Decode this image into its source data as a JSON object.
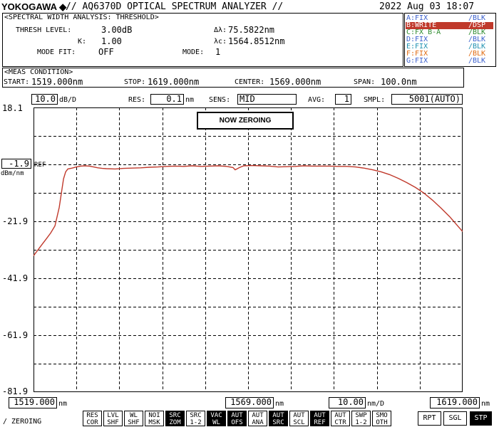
{
  "header": {
    "brand": "YOKOGAWA",
    "title": "// AQ6370D OPTICAL SPECTRUM ANALYZER //",
    "datetime": "2022 Aug 03 18:07"
  },
  "analysis": {
    "title": "<SPECTRAL WIDTH ANALYSIS: THRESHOLD>",
    "thresh_label": "THRESH LEVEL:",
    "thresh_value": "3.00dB",
    "k_label": "K:",
    "k_value": "1.00",
    "mode_fit_label": "MODE FIT:",
    "mode_fit_value": "OFF",
    "dlambda_label": "Δλ:",
    "dlambda_value": "75.5822nm",
    "lambdac_label": "λc:",
    "lambdac_value": "1564.8512nm",
    "mode_label": "MODE:",
    "mode_value": "1"
  },
  "traces": [
    {
      "name": "A:FIX",
      "mode": "/BLK",
      "color": "#3a5fcd",
      "active": false
    },
    {
      "name": "B:WRITE",
      "mode": "/DSP",
      "color": "#c0392b",
      "active": true
    },
    {
      "name": "C:FX B-A",
      "mode": "/BLK",
      "color": "#2e8b2e",
      "active": false
    },
    {
      "name": "D:FIX",
      "mode": "/BLK",
      "color": "#3a5fcd",
      "active": false
    },
    {
      "name": "E:FIX",
      "mode": "/BLK",
      "color": "#1e90b0",
      "active": false
    },
    {
      "name": "F:FIX",
      "mode": "/BLK",
      "color": "#e06a10",
      "active": false
    },
    {
      "name": "G:FIX",
      "mode": "/BLK",
      "color": "#3a5fcd",
      "active": false
    }
  ],
  "meas": {
    "title": "<MEAS CONDITION>",
    "start_label": "START:",
    "start_value": "1519.000nm",
    "stop_label": "STOP:",
    "stop_value": "1619.000nm",
    "center_label": "CENTER:",
    "center_value": "1569.000nm",
    "span_label": "SPAN:",
    "span_value": "100.0nm"
  },
  "settings": {
    "scale_value": "10.0",
    "scale_unit": "dB/D",
    "res_label": "RES:",
    "res_value": "0.1",
    "res_unit": "nm",
    "sens_label": "SENS:",
    "sens_value": "MID",
    "avg_label": "AVG:",
    "avg_value": "1",
    "smpl_label": "SMPL:",
    "smpl_value": "5001(AUTO)"
  },
  "plot": {
    "ref_value": "-1.9",
    "ref_tag": "REF",
    "ref_unit": "dBm/nm",
    "y_ticks": [
      "18.1",
      "-21.9",
      "-41.9",
      "-61.9",
      "-81.9"
    ],
    "zeroing_message": "NOW ZEROING",
    "x_start": "1519.000",
    "x_start_unit": "nm",
    "x_center": "1569.000",
    "x_center_unit": "nm",
    "x_div": "10.00",
    "x_div_unit": "nm/D",
    "x_stop": "1619.000",
    "x_stop_unit": "nm",
    "trace_color": "#c0392b"
  },
  "chart_data": {
    "type": "line",
    "xlim": [
      1519,
      1619
    ],
    "ylim": [
      -81.9,
      18.1
    ],
    "x_divisions": 10,
    "y_divisions": 10,
    "grid": true,
    "series": [
      {
        "x": [
          1519,
          1520,
          1521,
          1522,
          1523,
          1524,
          1525,
          1526,
          1526.5,
          1527,
          1528,
          1529,
          1530,
          1531,
          1532,
          1533,
          1534,
          1535,
          1536,
          1538,
          1540,
          1542,
          1544,
          1546,
          1548,
          1550,
          1552,
          1554,
          1556,
          1558,
          1560,
          1562,
          1564,
          1565.5,
          1566,
          1567,
          1568,
          1570,
          1572,
          1574,
          1576,
          1578,
          1580,
          1582,
          1584,
          1586,
          1588,
          1590,
          1592,
          1594,
          1596,
          1598,
          1600,
          1602,
          1604,
          1606,
          1608,
          1610,
          1612,
          1614,
          1616,
          1618,
          1619
        ],
        "y": [
          -34,
          -32,
          -30,
          -28,
          -26,
          -23.5,
          -17,
          -7,
          -4.5,
          -3.5,
          -3.2,
          -2.8,
          -2.5,
          -2.4,
          -2.5,
          -2.8,
          -3.1,
          -3.3,
          -3.4,
          -3.5,
          -3.3,
          -3.2,
          -3.1,
          -2.9,
          -2.8,
          -2.6,
          -2.5,
          -2.6,
          -2.4,
          -2.6,
          -2.5,
          -2.4,
          -2.6,
          -3.0,
          -3.8,
          -3.0,
          -2.4,
          -2.3,
          -2.4,
          -2.5,
          -2.8,
          -2.7,
          -2.6,
          -2.4,
          -2.5,
          -2.5,
          -2.5,
          -2.6,
          -2.6,
          -2.8,
          -3.2,
          -3.8,
          -4.5,
          -5.5,
          -6.8,
          -8.3,
          -10,
          -12,
          -14.5,
          -17.3,
          -20.3,
          -23.8,
          -25.5
        ]
      }
    ]
  },
  "softkeys": [
    {
      "l1": "RES",
      "l2": "COR",
      "on": false
    },
    {
      "l1": "LVL",
      "l2": "SHF",
      "on": false
    },
    {
      "l1": "WL",
      "l2": "SHF",
      "on": false
    },
    {
      "l1": "NOI",
      "l2": "MSK",
      "on": false
    },
    {
      "l1": "SRC",
      "l2": "ZOM",
      "on": true
    },
    {
      "l1": "SRC",
      "l2": "1-2",
      "on": false
    },
    {
      "l1": "VAC",
      "l2": "WL",
      "on": true
    },
    {
      "l1": "AUT",
      "l2": "OFS",
      "on": true
    },
    {
      "l1": "AUT",
      "l2": "ANA",
      "on": false
    },
    {
      "l1": "AUT",
      "l2": "SRC",
      "on": true
    },
    {
      "l1": "AUT",
      "l2": "SCL",
      "on": false
    },
    {
      "l1": "AUT",
      "l2": "REF",
      "on": true
    },
    {
      "l1": "AUT",
      "l2": "CTR",
      "on": false
    },
    {
      "l1": "SWP",
      "l2": "1-2",
      "on": false
    },
    {
      "l1": "SMO",
      "l2": "OTH",
      "on": false
    }
  ],
  "run_buttons": [
    {
      "label": "RPT",
      "on": false
    },
    {
      "label": "SGL",
      "on": false
    },
    {
      "label": "STP",
      "on": true
    }
  ],
  "status": {
    "message": "/ ZEROING"
  }
}
